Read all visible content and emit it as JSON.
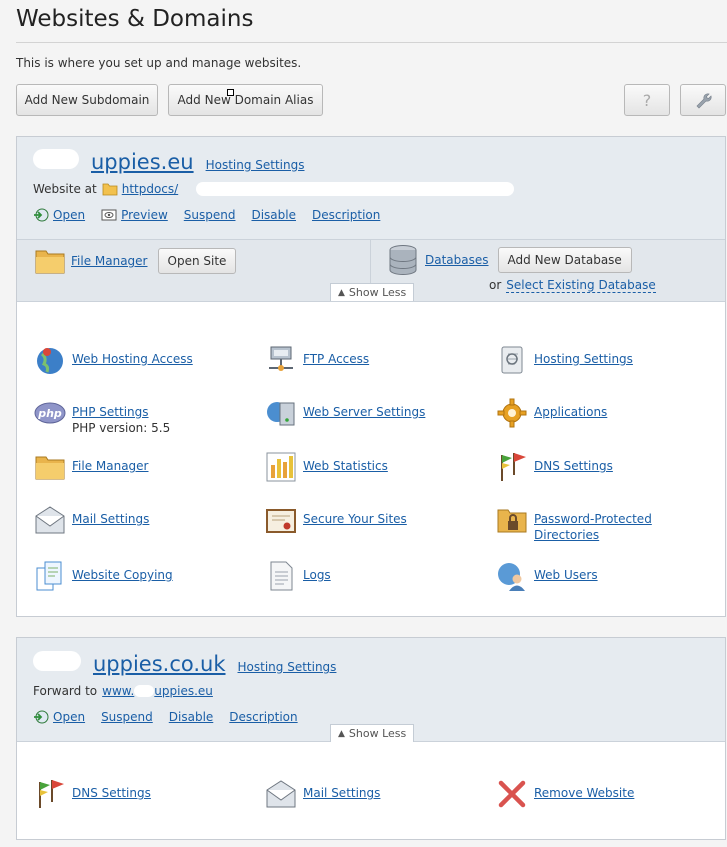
{
  "page": {
    "title": "Websites & Domains",
    "intro": "This is where you set up and manage websites.",
    "add_subdomain_label": "Add New Subdomain",
    "add_alias_label": "Add New Domain Alias",
    "help_label": "?"
  },
  "site1": {
    "domain": "uppies.eu",
    "hosting_settings": "Hosting Settings",
    "website_at_label": "Website at",
    "docroot": "httpdocs/",
    "actions": [
      "Open",
      "Preview",
      "Suspend",
      "Disable",
      "Description"
    ],
    "file_manager": "File Manager",
    "open_site": "Open Site",
    "databases": "Databases",
    "add_database": "Add New Database",
    "or_label": "or",
    "select_database": "Select Existing Database",
    "show_less": "Show Less",
    "items": [
      {
        "label": "Web Hosting Access",
        "icon": "globe-user-icon"
      },
      {
        "label": "FTP Access",
        "icon": "ftp-network-icon"
      },
      {
        "label": "Hosting Settings",
        "icon": "scroll-settings-icon"
      },
      {
        "label": "PHP Settings",
        "icon": "php-icon",
        "note": "PHP version: 5.5"
      },
      {
        "label": "Web Server Settings",
        "icon": "web-server-icon"
      },
      {
        "label": "Applications",
        "icon": "gear-icon"
      },
      {
        "label": "File Manager",
        "icon": "folder-icon"
      },
      {
        "label": "Web Statistics",
        "icon": "bar-chart-icon"
      },
      {
        "label": "DNS Settings",
        "icon": "flags-icon"
      },
      {
        "label": "Mail Settings",
        "icon": "envelope-icon"
      },
      {
        "label": "Secure Your Sites",
        "icon": "certificate-icon"
      },
      {
        "label": "Password-Protected Directories",
        "icon": "locked-folder-icon"
      },
      {
        "label": "Website Copying",
        "icon": "copy-pages-icon"
      },
      {
        "label": "Logs",
        "icon": "log-document-icon"
      },
      {
        "label": "Web Users",
        "icon": "globe-person-icon"
      }
    ]
  },
  "site2": {
    "domain": "uppies.co.uk",
    "hosting_settings": "Hosting Settings",
    "forward_label": "Forward to",
    "forward_target_prefix": "www.",
    "forward_target_suffix": "uppies.eu",
    "actions": [
      "Open",
      "Suspend",
      "Disable",
      "Description"
    ],
    "show_less": "Show Less",
    "items": [
      {
        "label": "DNS Settings",
        "icon": "flags-icon"
      },
      {
        "label": "Mail Settings",
        "icon": "envelope-icon"
      },
      {
        "label": "Remove Website",
        "icon": "red-x-icon"
      }
    ]
  },
  "colors": {
    "link": "#1a5ea6",
    "panel_head": "#e6ebf0",
    "panel_border": "#c7ccd3"
  }
}
